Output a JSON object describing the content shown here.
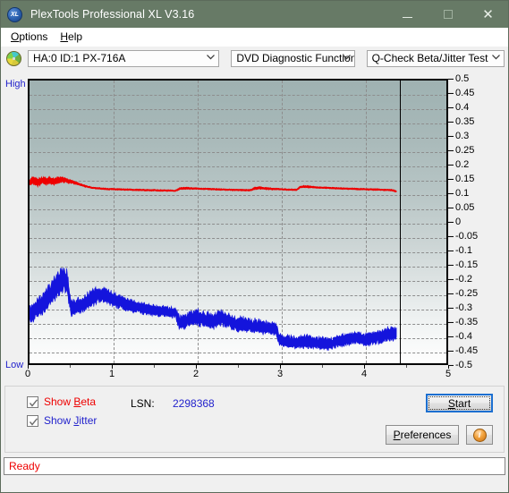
{
  "window": {
    "title": "PlexTools Professional XL V3.16",
    "app_icon": "xl-logo-icon",
    "minimize_label": "─",
    "maximize_label": "□",
    "close_label": "✕"
  },
  "menu": {
    "items": [
      {
        "label": "Options",
        "mnemonic": "O",
        "rest": "ptions"
      },
      {
        "label": "Help",
        "mnemonic": "H",
        "rest": "elp"
      }
    ]
  },
  "selectors": {
    "drive": {
      "value": "HA:0 ID:1  PX-716A",
      "icon": "optical-disc-icon"
    },
    "function": {
      "value": "DVD Diagnostic Functions"
    },
    "test": {
      "value": "Q-Check Beta/Jitter Test"
    }
  },
  "chart_data": {
    "type": "line",
    "title": "",
    "xlabel": "",
    "ylabel": "",
    "axis_left_top_label": "High",
    "axis_left_bottom_label": "Low",
    "xlim": [
      0,
      5
    ],
    "ylim": [
      -0.5,
      0.5
    ],
    "xticks": [
      0,
      1,
      2,
      3,
      4,
      5
    ],
    "xtick_labels": [
      "0",
      "1",
      "2",
      "3",
      "4",
      "5"
    ],
    "yticks": [
      0.5,
      0.45,
      0.4,
      0.35,
      0.3,
      0.25,
      0.2,
      0.15,
      0.1,
      0.05,
      0,
      -0.05,
      -0.1,
      -0.15,
      -0.2,
      -0.25,
      -0.3,
      -0.35,
      -0.4,
      -0.45,
      -0.5
    ],
    "ytick_labels": [
      "0.5",
      "0.45",
      "0.4",
      "0.35",
      "0.3",
      "0.25",
      "0.2",
      "0.15",
      "0.1",
      "0.05",
      "0",
      "-0.05",
      "-0.1",
      "-0.15",
      "-0.2",
      "-0.25",
      "-0.3",
      "-0.35",
      "-0.4",
      "-0.45",
      "-0.5"
    ],
    "grid": true,
    "grid_style": "dashed",
    "grid_color": "#8d8d8d",
    "data_end_marker_x": 4.4,
    "background_gradient": [
      "#9fb2b2",
      "#fefefe"
    ],
    "series": [
      {
        "name": "Beta",
        "color": "#ee0000",
        "x": [
          0.0,
          0.05,
          0.1,
          0.15,
          0.2,
          0.25,
          0.3,
          0.35,
          0.4,
          0.45,
          0.5,
          0.55,
          0.6,
          0.65,
          0.7,
          0.75,
          0.8,
          0.85,
          0.9,
          0.95,
          1.0,
          1.05,
          1.1,
          1.15,
          1.2,
          1.25,
          1.3,
          1.35,
          1.4,
          1.45,
          1.5,
          1.55,
          1.6,
          1.65,
          1.7,
          1.75,
          1.8,
          1.85,
          1.9,
          1.95,
          2.0,
          2.05,
          2.1,
          2.15,
          2.2,
          2.25,
          2.3,
          2.35,
          2.4,
          2.45,
          2.5,
          2.55,
          2.6,
          2.65,
          2.7,
          2.75,
          2.8,
          2.85,
          2.9,
          2.95,
          3.0,
          3.05,
          3.1,
          3.15,
          3.2,
          3.25,
          3.3,
          3.35,
          3.4,
          3.45,
          3.5,
          3.55,
          3.6,
          3.65,
          3.7,
          3.75,
          3.8,
          3.85,
          3.9,
          3.95,
          4.0,
          4.05,
          4.1,
          4.15,
          4.2,
          4.25,
          4.3,
          4.35,
          4.4
        ],
        "y": [
          0.142,
          0.145,
          0.14,
          0.146,
          0.143,
          0.147,
          0.142,
          0.148,
          0.15,
          0.145,
          0.142,
          0.138,
          0.133,
          0.128,
          0.124,
          0.121,
          0.119,
          0.118,
          0.117,
          0.116,
          0.116,
          0.115,
          0.115,
          0.114,
          0.114,
          0.113,
          0.113,
          0.113,
          0.112,
          0.112,
          0.112,
          0.111,
          0.111,
          0.111,
          0.111,
          0.11,
          0.118,
          0.119,
          0.119,
          0.118,
          0.118,
          0.117,
          0.117,
          0.116,
          0.116,
          0.115,
          0.115,
          0.114,
          0.114,
          0.113,
          0.113,
          0.113,
          0.112,
          0.112,
          0.118,
          0.12,
          0.119,
          0.118,
          0.117,
          0.116,
          0.116,
          0.115,
          0.114,
          0.114,
          0.113,
          0.124,
          0.125,
          0.124,
          0.123,
          0.122,
          0.121,
          0.121,
          0.12,
          0.119,
          0.119,
          0.118,
          0.118,
          0.117,
          0.117,
          0.116,
          0.116,
          0.115,
          0.115,
          0.114,
          0.114,
          0.113,
          0.113,
          0.112,
          0.108
        ],
        "band_half_width": [
          0.013,
          0.013,
          0.013,
          0.013,
          0.013,
          0.012,
          0.012,
          0.011,
          0.01,
          0.008,
          0.006,
          0.005,
          0.004,
          0.004,
          0.003,
          0.003,
          0.003,
          0.003,
          0.003,
          0.003,
          0.003,
          0.003,
          0.003,
          0.003,
          0.003,
          0.003,
          0.003,
          0.003,
          0.003,
          0.003,
          0.003,
          0.003,
          0.003,
          0.003,
          0.003,
          0.003,
          0.004,
          0.004,
          0.004,
          0.003,
          0.003,
          0.003,
          0.003,
          0.003,
          0.003,
          0.003,
          0.003,
          0.003,
          0.003,
          0.003,
          0.003,
          0.003,
          0.003,
          0.003,
          0.005,
          0.005,
          0.004,
          0.004,
          0.004,
          0.003,
          0.003,
          0.003,
          0.003,
          0.003,
          0.003,
          0.004,
          0.004,
          0.004,
          0.003,
          0.003,
          0.003,
          0.003,
          0.003,
          0.003,
          0.003,
          0.003,
          0.003,
          0.003,
          0.003,
          0.003,
          0.003,
          0.003,
          0.003,
          0.003,
          0.003,
          0.003,
          0.003,
          0.003,
          0.003
        ]
      },
      {
        "name": "Jitter",
        "color": "#1414dc",
        "x": [
          0.0,
          0.05,
          0.1,
          0.15,
          0.2,
          0.25,
          0.3,
          0.35,
          0.4,
          0.45,
          0.5,
          0.55,
          0.6,
          0.65,
          0.7,
          0.75,
          0.8,
          0.85,
          0.9,
          0.95,
          1.0,
          1.05,
          1.1,
          1.15,
          1.2,
          1.25,
          1.3,
          1.35,
          1.4,
          1.45,
          1.5,
          1.55,
          1.6,
          1.65,
          1.7,
          1.75,
          1.8,
          1.85,
          1.9,
          1.95,
          2.0,
          2.05,
          2.1,
          2.15,
          2.2,
          2.25,
          2.3,
          2.35,
          2.4,
          2.45,
          2.5,
          2.55,
          2.6,
          2.65,
          2.7,
          2.75,
          2.8,
          2.85,
          2.9,
          2.95,
          3.0,
          3.05,
          3.1,
          3.15,
          3.2,
          3.25,
          3.3,
          3.35,
          3.4,
          3.45,
          3.5,
          3.55,
          3.6,
          3.65,
          3.7,
          3.75,
          3.8,
          3.85,
          3.9,
          3.95,
          4.0,
          4.05,
          4.1,
          4.15,
          4.2,
          4.25,
          4.3,
          4.35,
          4.4
        ],
        "y": [
          -0.33,
          -0.318,
          -0.3,
          -0.292,
          -0.275,
          -0.255,
          -0.235,
          -0.215,
          -0.205,
          -0.212,
          -0.31,
          -0.3,
          -0.295,
          -0.29,
          -0.278,
          -0.27,
          -0.262,
          -0.258,
          -0.262,
          -0.268,
          -0.272,
          -0.28,
          -0.285,
          -0.29,
          -0.296,
          -0.3,
          -0.303,
          -0.306,
          -0.308,
          -0.31,
          -0.312,
          -0.314,
          -0.316,
          -0.318,
          -0.32,
          -0.322,
          -0.356,
          -0.35,
          -0.344,
          -0.34,
          -0.338,
          -0.34,
          -0.344,
          -0.348,
          -0.352,
          -0.344,
          -0.34,
          -0.346,
          -0.352,
          -0.356,
          -0.36,
          -0.362,
          -0.364,
          -0.366,
          -0.368,
          -0.37,
          -0.372,
          -0.374,
          -0.376,
          -0.378,
          -0.418,
          -0.42,
          -0.422,
          -0.424,
          -0.426,
          -0.424,
          -0.422,
          -0.424,
          -0.426,
          -0.428,
          -0.43,
          -0.432,
          -0.43,
          -0.428,
          -0.424,
          -0.42,
          -0.418,
          -0.414,
          -0.412,
          -0.41,
          -0.412,
          -0.416,
          -0.414,
          -0.41,
          -0.406,
          -0.402,
          -0.398,
          -0.394,
          -0.392
        ],
        "band_half_width": [
          0.03,
          0.032,
          0.034,
          0.036,
          0.038,
          0.04,
          0.042,
          0.044,
          0.046,
          0.042,
          0.028,
          0.026,
          0.026,
          0.027,
          0.028,
          0.028,
          0.028,
          0.028,
          0.027,
          0.026,
          0.025,
          0.024,
          0.023,
          0.022,
          0.022,
          0.021,
          0.021,
          0.02,
          0.02,
          0.02,
          0.019,
          0.019,
          0.019,
          0.018,
          0.018,
          0.018,
          0.026,
          0.026,
          0.026,
          0.026,
          0.026,
          0.026,
          0.026,
          0.026,
          0.026,
          0.026,
          0.026,
          0.026,
          0.025,
          0.025,
          0.025,
          0.025,
          0.024,
          0.024,
          0.024,
          0.024,
          0.023,
          0.023,
          0.023,
          0.023,
          0.022,
          0.022,
          0.022,
          0.022,
          0.022,
          0.022,
          0.022,
          0.022,
          0.022,
          0.022,
          0.022,
          0.022,
          0.022,
          0.022,
          0.022,
          0.022,
          0.022,
          0.022,
          0.022,
          0.022,
          0.022,
          0.022,
          0.022,
          0.023,
          0.023,
          0.024,
          0.024,
          0.024,
          0.024
        ]
      }
    ]
  },
  "controls": {
    "show_beta": {
      "label": "Show Beta",
      "pre": "Show ",
      "mnemonic": "B",
      "post": "eta",
      "checked": true,
      "color": "#ee0000"
    },
    "show_jitter": {
      "label": "Show Jitter",
      "pre": "Show ",
      "mnemonic": "J",
      "post": "itter",
      "checked": true,
      "color": "#2222cc"
    },
    "lsn_label": "LSN:",
    "lsn_value": "2298368",
    "start_button": {
      "label": "Start",
      "mnemonic": "S",
      "pre": "",
      "post": "tart",
      "focused": true
    },
    "preferences_button": {
      "label": "Preferences",
      "mnemonic": "P",
      "pre": "",
      "post": "references"
    },
    "info_button": {
      "label": "i",
      "icon": "info-icon"
    }
  },
  "statusbar": {
    "text": "Ready",
    "color": "#ee0000"
  }
}
